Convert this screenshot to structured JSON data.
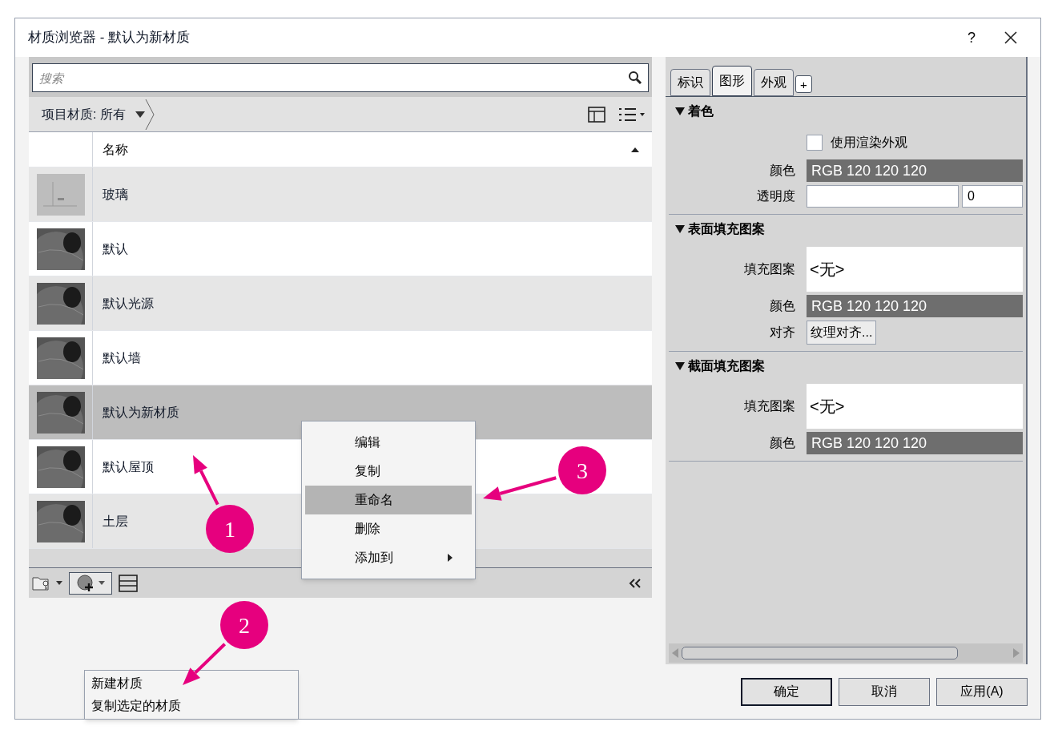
{
  "window": {
    "title": "材质浏览器 - 默认为新材质",
    "help": "?"
  },
  "search": {
    "placeholder": "搜索"
  },
  "library_filter": {
    "label": "项目材质: 所有"
  },
  "table": {
    "columns": [
      "名称"
    ],
    "rows": [
      {
        "name": "玻璃",
        "kind": "glass",
        "selected": false
      },
      {
        "name": "默认",
        "kind": "sphere",
        "selected": false
      },
      {
        "name": "默认光源",
        "kind": "sphere",
        "selected": false
      },
      {
        "name": "默认墙",
        "kind": "sphere",
        "selected": false
      },
      {
        "name": "默认为新材质",
        "kind": "sphere",
        "selected": true
      },
      {
        "name": "默认屋顶",
        "kind": "sphere",
        "selected": false
      },
      {
        "name": "土层",
        "kind": "sphere",
        "selected": false
      }
    ]
  },
  "context_menu": [
    {
      "label": "编辑",
      "selected": false,
      "submenu": false
    },
    {
      "label": "复制",
      "selected": false,
      "submenu": false
    },
    {
      "label": "重命名",
      "selected": true,
      "submenu": false
    },
    {
      "label": "删除",
      "selected": false,
      "submenu": false
    },
    {
      "label": "添加到",
      "selected": false,
      "submenu": true
    }
  ],
  "new_material_menu": [
    "新建材质",
    "复制选定的材质"
  ],
  "tabs": [
    {
      "label": "标识",
      "selected": false
    },
    {
      "label": "图形",
      "selected": true
    },
    {
      "label": "外观",
      "selected": false
    }
  ],
  "add_tab": "+",
  "sections": [
    {
      "title": "着色",
      "expanded": true,
      "fields": [
        {
          "kind": "checkbox",
          "label": "使用渲染外观",
          "checked": false
        },
        {
          "kind": "color",
          "label": "颜色",
          "value": "RGB 120 120 120"
        },
        {
          "kind": "slider",
          "label": "透明度",
          "value": "0"
        }
      ]
    },
    {
      "title": "表面填充图案",
      "expanded": true,
      "fields": [
        {
          "kind": "pattern",
          "label": "填充图案",
          "value": "<无>"
        },
        {
          "kind": "color",
          "label": "颜色",
          "value": "RGB 120 120 120"
        },
        {
          "kind": "button",
          "label": "对齐",
          "value": "纹理对齐..."
        }
      ]
    },
    {
      "title": "截面填充图案",
      "expanded": true,
      "fields": [
        {
          "kind": "pattern",
          "label": "填充图案",
          "value": "<无>"
        },
        {
          "kind": "color",
          "label": "颜色",
          "value": "RGB 120 120 120"
        }
      ]
    }
  ],
  "buttons": [
    {
      "label": "确定",
      "default": true
    },
    {
      "label": "取消",
      "default": false
    },
    {
      "label": "应用(A)",
      "default": false
    }
  ],
  "callouts": [
    "1",
    "2",
    "3"
  ]
}
